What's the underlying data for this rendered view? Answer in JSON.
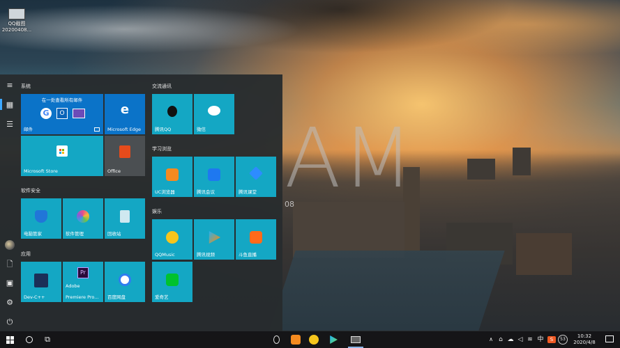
{
  "desktop": {
    "icon_label_line1": "QQ截图",
    "icon_label_line2": "20200408..."
  },
  "wallpaper": {
    "big_text": "AM",
    "small_text": "08"
  },
  "start_menu": {
    "groups": {
      "system": "系统",
      "software_security": "软件安全",
      "apps": "应用",
      "communication": "交流通讯",
      "learning": "学习浏览",
      "entertainment": "娱乐"
    },
    "tiles": {
      "mail_top_text": "在一处查看所有邮件",
      "mail": "邮件",
      "edge": "Microsoft Edge",
      "store": "Microsoft Store",
      "office": "Office",
      "pc_manager": "电脑管家",
      "software_manager": "软件管理",
      "recycle_bin": "回收站",
      "devcpp": "Dev-C++",
      "premiere_line1": "Adobe",
      "premiere_line2": "Premiere Pro...",
      "baidu_pan": "百度网盘",
      "tencent_qq": "腾讯QQ",
      "wechat": "微信",
      "uc_browser": "UC浏览器",
      "tencent_meeting": "腾讯会议",
      "tencent_classroom": "腾讯课堂",
      "qqmusic": "QQMusic",
      "tencent_video": "腾讯视频",
      "douyu": "斗鱼直播",
      "iqiyi": "爱奇艺"
    }
  },
  "taskbar": {
    "ime": "中",
    "ime_badge": "S",
    "notification_count": "53",
    "time": "10:32",
    "date": "2020/4/8"
  },
  "colors": {
    "tile_cyan": "#14a7c4",
    "tile_blue": "#0b73c8",
    "accent": "#3da8ff"
  },
  "icons": [
    "hamburger-icon",
    "tiles-icon",
    "list-icon",
    "avatar",
    "document-icon",
    "pictures-icon",
    "settings-icon",
    "power-icon",
    "windows-icon",
    "search-icon",
    "task-view-icon"
  ]
}
